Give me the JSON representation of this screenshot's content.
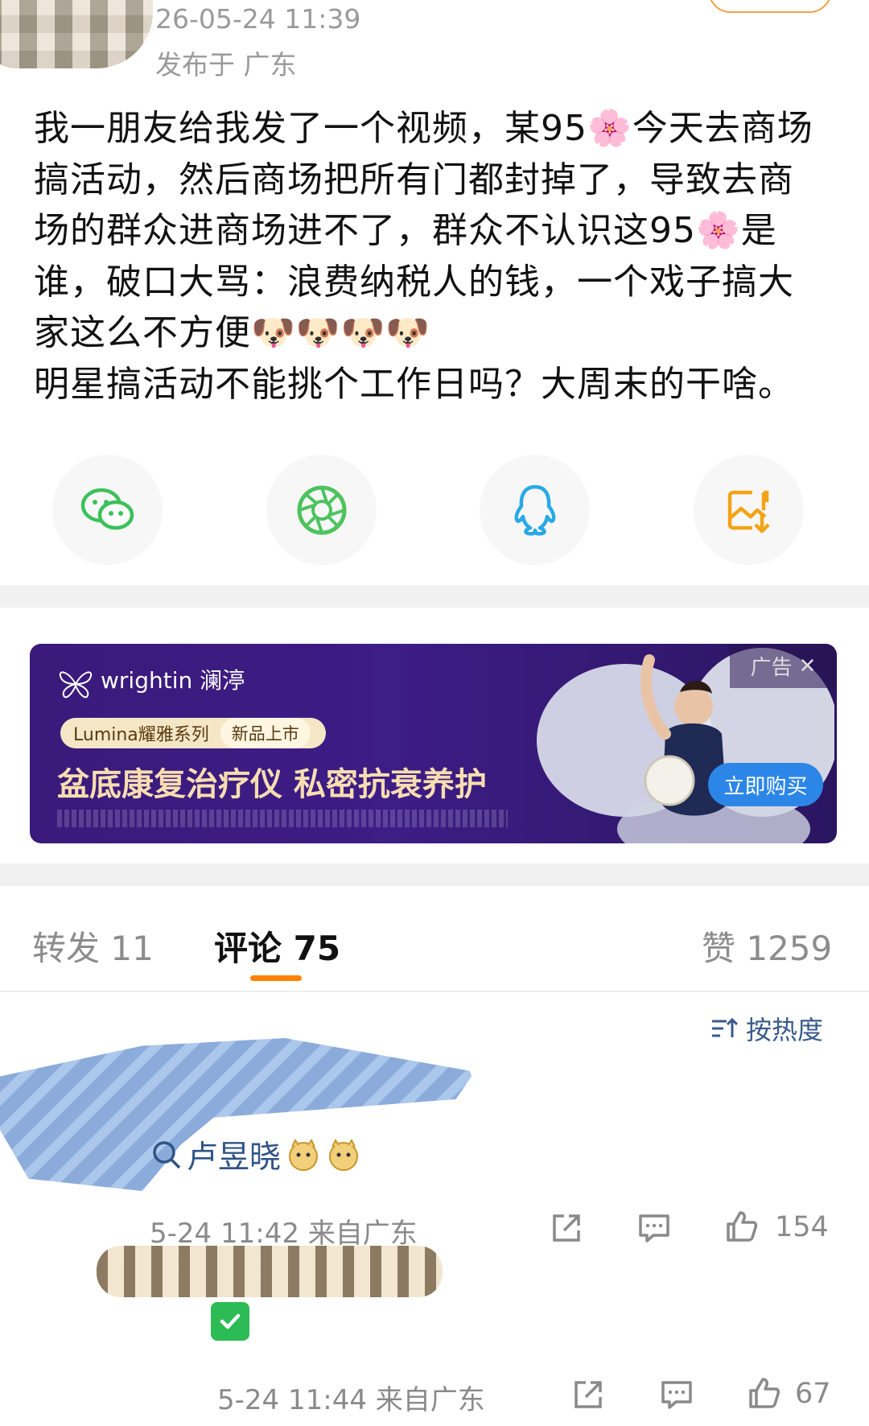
{
  "post": {
    "time": "26-05-24 11:39",
    "location": "发布于 广东",
    "line1a": "我一朋友给我发了一个视频，某95",
    "line1b": "今天去商场",
    "line2": "搞活动，然后商场把所有门都封掉了，导致去商",
    "line3a": "场的群众进商场进不了，群众不认识这95",
    "line3b": "是",
    "line4": "谁，破口大骂：浪费纳税人的钱，一个戏子搞大",
    "line5": "家这么不方便",
    "line6": "明星搞活动不能挑个工作日吗？大周末的干啥。",
    "flower_glyph": "🌸",
    "face_glyph": "🐶"
  },
  "share": {
    "icons": [
      "wechat-icon",
      "moments-icon",
      "qq-icon",
      "save-image-icon"
    ],
    "colors": {
      "wechat": "#3cc15a",
      "moments": "#4dc35e",
      "qq": "#28a9e6",
      "save": "#f4a316"
    }
  },
  "ad": {
    "brand": "wrightin 澜渟",
    "pill_series": "Lumina耀雅系列",
    "pill_new": "新品上市",
    "headline": "盆底康复治疗仪 私密抗衰养护",
    "tag": "广告",
    "close_glyph": "✕",
    "buy": "立即购买"
  },
  "tabs": {
    "repost": "转发 11",
    "comment": "评论 75",
    "like": "赞 1259"
  },
  "sort_label": "按热度",
  "comments": [
    {
      "mention": "卢昱晓",
      "meta": "5-24 11:42 来自广东",
      "likes": "154"
    },
    {
      "meta": "5-24 11:44 来自广东",
      "likes": "67"
    }
  ],
  "colors": {
    "accent": "#ff8200",
    "link": "#2f5486",
    "muted": "#8a8a8a"
  }
}
